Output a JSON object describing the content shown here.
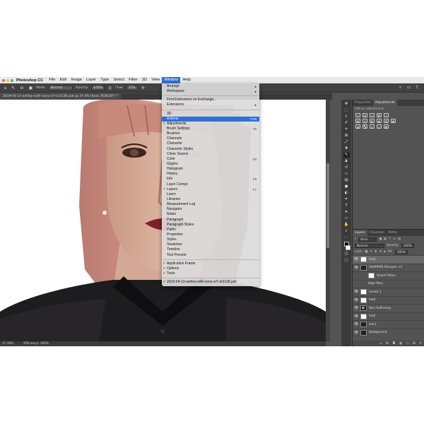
{
  "menubar": {
    "app_name": "Photoshop CC",
    "items": [
      "File",
      "Edit",
      "Image",
      "Layer",
      "Type",
      "Select",
      "Filter",
      "3D",
      "View",
      "Window",
      "Help"
    ],
    "active_item": "Window"
  },
  "options_bar": {
    "mode_label": "Mode:",
    "mode_value": "Normal",
    "opacity_label": "Opacity:",
    "opacity_value": "100%",
    "flow_label": "Flow:",
    "flow_value": "37%",
    "brush_size": "60"
  },
  "document": {
    "tab_title": "2019-04-13-ashley-with-sony-a7r-iii3138.psb @ 37.4% (heal, RGB/16*) *",
    "zoom": "37.39%",
    "efficiency": "Efficiency: 100%"
  },
  "window_menu": {
    "items": [
      {
        "label": "Arrange",
        "arrow": "▸"
      },
      {
        "label": "Workspace",
        "arrow": "▸"
      },
      {
        "sep": true
      },
      {
        "label": "Find Extensions on Exchange..."
      },
      {
        "label": "Extensions",
        "arrow": "▸"
      },
      {
        "sep": true
      },
      {
        "label": "3D"
      },
      {
        "label": "Actions",
        "shortcut": "⌥F9",
        "highlighted": true
      },
      {
        "label": "Adjustments",
        "checked": true
      },
      {
        "label": "Brush Settings",
        "shortcut": "F5"
      },
      {
        "label": "Brushes"
      },
      {
        "label": "Channels"
      },
      {
        "label": "Character"
      },
      {
        "label": "Character Styles"
      },
      {
        "label": "Clone Source"
      },
      {
        "label": "Color",
        "shortcut": "F6"
      },
      {
        "label": "Glyphs"
      },
      {
        "label": "Histogram"
      },
      {
        "label": "History"
      },
      {
        "label": "Info",
        "shortcut": "F8"
      },
      {
        "label": "Layer Comps"
      },
      {
        "label": "Layers",
        "shortcut": "F7",
        "checked": true
      },
      {
        "label": "Learn"
      },
      {
        "label": "Libraries"
      },
      {
        "label": "Measurement Log"
      },
      {
        "label": "Navigator"
      },
      {
        "label": "Notes"
      },
      {
        "label": "Paragraph"
      },
      {
        "label": "Paragraph Styles"
      },
      {
        "label": "Paths"
      },
      {
        "label": "Properties"
      },
      {
        "label": "Styles"
      },
      {
        "label": "Swatches"
      },
      {
        "label": "Timeline"
      },
      {
        "label": "Tool Presets"
      },
      {
        "sep": true
      },
      {
        "label": "Application Frame",
        "checked": true
      },
      {
        "label": "Options",
        "checked": true
      },
      {
        "label": "Tools",
        "checked": true
      },
      {
        "sep": true
      },
      {
        "label": "2019-04-13-ashley-with-sony-a7r-iii3138.psb",
        "checked": true
      }
    ]
  },
  "panels": {
    "top_tabs": [
      "Properties",
      "Adjustments"
    ],
    "active_top_tab": "Adjustments",
    "add_adjustment_hint": "Add an adjustment",
    "layer_tabs": [
      "Layers",
      "Channels",
      "Paths"
    ],
    "kind_label": "Kind",
    "blend_mode": "Normal",
    "opacity_label": "Opacity:",
    "opacity_value": "100%",
    "lock_label": "Lock:",
    "fill_label": "Fill:",
    "fill_value": "100%"
  },
  "layers": [
    {
      "name": "heal",
      "thumb": "white",
      "selected": true
    },
    {
      "name": "SHARPEN Sharpen +1",
      "thumb": "dark"
    },
    {
      "name": "Smart Filters",
      "thumb": "white",
      "indent": true
    },
    {
      "name": "High Pass",
      "indent": true
    },
    {
      "name": "Levels 1",
      "thumb": "white"
    },
    {
      "name": "heal",
      "thumb": "white"
    },
    {
      "name": "Skin Softening",
      "thumb": "mask"
    },
    {
      "name": "heal",
      "thumb": "white"
    },
    {
      "name": "clar1",
      "thumb": "dark"
    },
    {
      "name": "Background",
      "thumb": "dark"
    }
  ],
  "colors": {
    "menu_highlight": "#2f6fd6",
    "ui_background": "#535353"
  }
}
